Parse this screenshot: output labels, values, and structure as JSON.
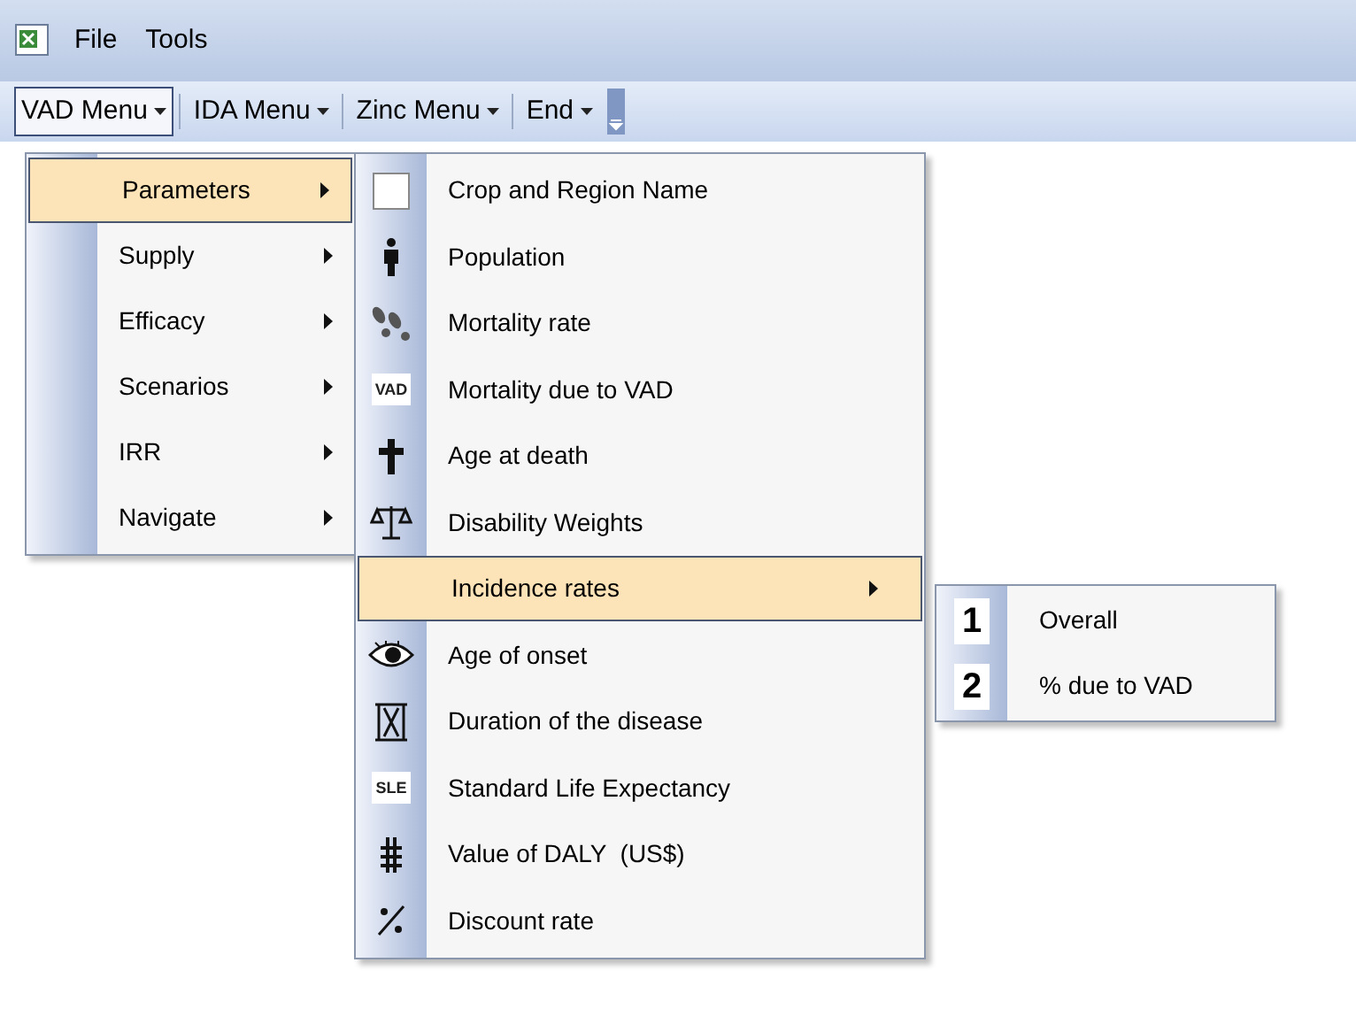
{
  "menubar": [
    "File",
    "Tools"
  ],
  "toolbar": [
    {
      "label": "VAD Menu",
      "selected": true
    },
    {
      "label": "IDA Menu",
      "selected": false
    },
    {
      "label": "Zinc Menu",
      "selected": false
    },
    {
      "label": "End",
      "selected": false
    }
  ],
  "menu": [
    {
      "label": "Parameters",
      "selected": true
    },
    {
      "label": "Supply",
      "selected": false
    },
    {
      "label": "Efficacy",
      "selected": false
    },
    {
      "label": "Scenarios",
      "selected": false
    },
    {
      "label": "IRR",
      "selected": false
    },
    {
      "label": "Navigate",
      "selected": false
    }
  ],
  "submenu": [
    {
      "label": "Crop and Region Name",
      "selected": false
    },
    {
      "label": "Population",
      "selected": false
    },
    {
      "label": "Mortality rate",
      "selected": false
    },
    {
      "label": "Mortality due to VAD",
      "icon_text": "VAD",
      "selected": false
    },
    {
      "label": "Age at death",
      "selected": false
    },
    {
      "label": "Disability Weights",
      "selected": false
    },
    {
      "label": "Incidence rates",
      "has_submenu": true,
      "selected": true
    },
    {
      "label": "Age of onset",
      "selected": false
    },
    {
      "label": "Duration of the disease",
      "selected": false
    },
    {
      "label": "Standard Life Expectancy",
      "icon_text": "SLE",
      "selected": false
    },
    {
      "label": "Value of DALY  (US$)",
      "selected": false
    },
    {
      "label": "Discount rate",
      "selected": false
    }
  ],
  "incidence_submenu": [
    {
      "number": "1",
      "label": "Overall"
    },
    {
      "number": "2",
      "label": "% due to VAD"
    }
  ]
}
